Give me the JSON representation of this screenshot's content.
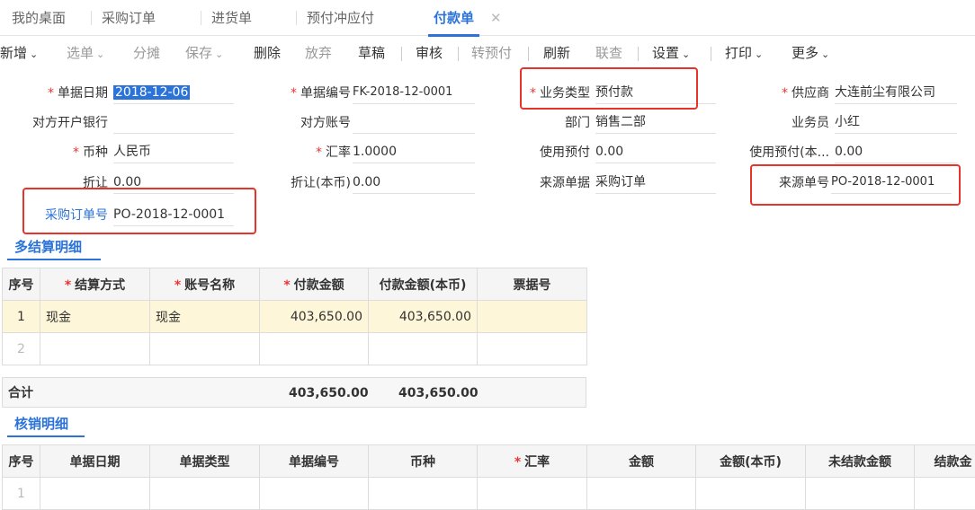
{
  "tabs": [
    {
      "label": "我的桌面"
    },
    {
      "label": "采购订单"
    },
    {
      "label": "进货单"
    },
    {
      "label": "预付冲应付"
    },
    {
      "label": "付款单",
      "active": true
    }
  ],
  "tab_close": "✕",
  "toolbar": {
    "new": "新增",
    "select": "选单",
    "allocate": "分摊",
    "save": "保存",
    "delete": "删除",
    "discard": "放弃",
    "draft": "草稿",
    "audit": "审核",
    "to_prepay": "转预付",
    "refresh": "刷新",
    "query": "联查",
    "settings": "设置",
    "print": "打印",
    "more": "更多",
    "caret": "⌄"
  },
  "form": {
    "doc_date": {
      "label": "单据日期",
      "value": "2018-12-06"
    },
    "doc_no": {
      "label": "单据编号",
      "value": "FK-2018-12-0001"
    },
    "biz_type": {
      "label": "业务类型",
      "value": "预付款"
    },
    "supplier": {
      "label": "供应商",
      "value": "大连前尘有限公司"
    },
    "bank": {
      "label": "对方开户银行",
      "value": ""
    },
    "account": {
      "label": "对方账号",
      "value": ""
    },
    "department": {
      "label": "部门",
      "value": "销售二部"
    },
    "salesman": {
      "label": "业务员",
      "value": "小红"
    },
    "currency": {
      "label": "币种",
      "value": "人民币"
    },
    "rate": {
      "label": "汇率",
      "value": "1.0000"
    },
    "use_prepay": {
      "label": "使用预付",
      "value": "0.00"
    },
    "use_prepay_local": {
      "label": "使用预付(本...",
      "value": "0.00"
    },
    "discount": {
      "label": "折让",
      "value": "0.00"
    },
    "discount_local": {
      "label": "折让(本币)",
      "value": "0.00"
    },
    "source_doc": {
      "label": "来源单据",
      "value": "采购订单"
    },
    "source_no": {
      "label": "来源单号",
      "value": "PO-2018-12-0001"
    },
    "po_no": {
      "label": "采购订单号",
      "value": "PO-2018-12-0001"
    }
  },
  "settle": {
    "title": "多结算明细",
    "headers": [
      "序号",
      "结算方式",
      "账号名称",
      "付款金额",
      "付款金额(本币)",
      "票据号"
    ],
    "rows": [
      [
        "1",
        "现金",
        "现金",
        "403,650.00",
        "403,650.00",
        ""
      ],
      [
        "2",
        "",
        "",
        "",
        "",
        ""
      ]
    ],
    "total_label": "合计",
    "total_amount": "403,650.00",
    "total_amount_local": "403,650.00"
  },
  "writeoff": {
    "title": "核销明细",
    "headers": [
      "序号",
      "单据日期",
      "单据类型",
      "单据编号",
      "币种",
      "汇率",
      "金额",
      "金额(本币)",
      "未结款金额",
      "结款金"
    ],
    "rows": [
      [
        "1",
        "",
        "",
        "",
        "",
        "",
        "",
        "",
        "",
        ""
      ]
    ]
  }
}
